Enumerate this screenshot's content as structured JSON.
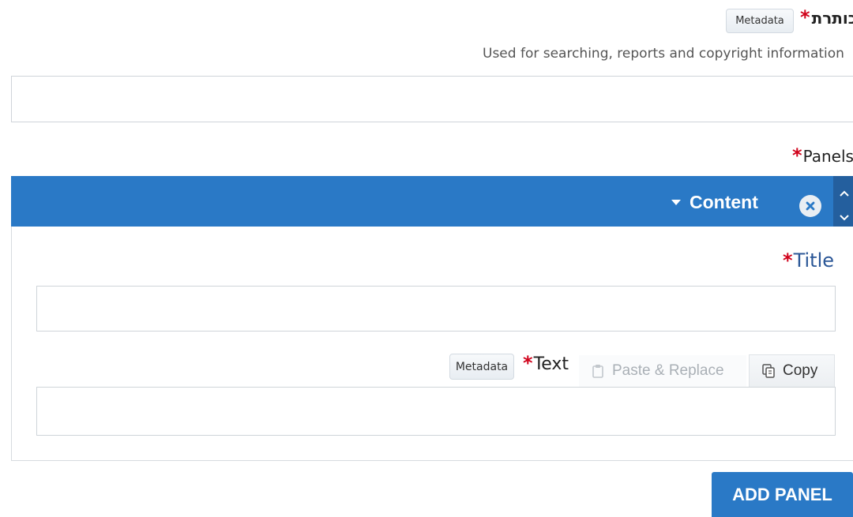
{
  "title_field": {
    "label": "כותרת",
    "required_mark": "*",
    "metadata_label": "Metadata",
    "help_text": "Used for searching, reports and copyright information",
    "value": ""
  },
  "panels": {
    "label": "Panels",
    "required_mark": "*",
    "items": [
      {
        "header_label": "Content",
        "fields": {
          "title": {
            "label": "Title",
            "required_mark": "*",
            "value": ""
          },
          "text": {
            "label": "Text",
            "required_mark": "*",
            "metadata_label": "Metadata",
            "paste_replace_label": "Paste & Replace",
            "copy_label": "Copy",
            "value": ""
          }
        }
      }
    ],
    "add_button_label": "ADD PANEL"
  },
  "colors": {
    "accent": "#2a79c6",
    "required": "#d0021b"
  },
  "icons": [
    "caret-down-icon",
    "close-icon",
    "chevron-up-icon",
    "chevron-down-icon",
    "paste-icon",
    "copy-icon"
  ]
}
